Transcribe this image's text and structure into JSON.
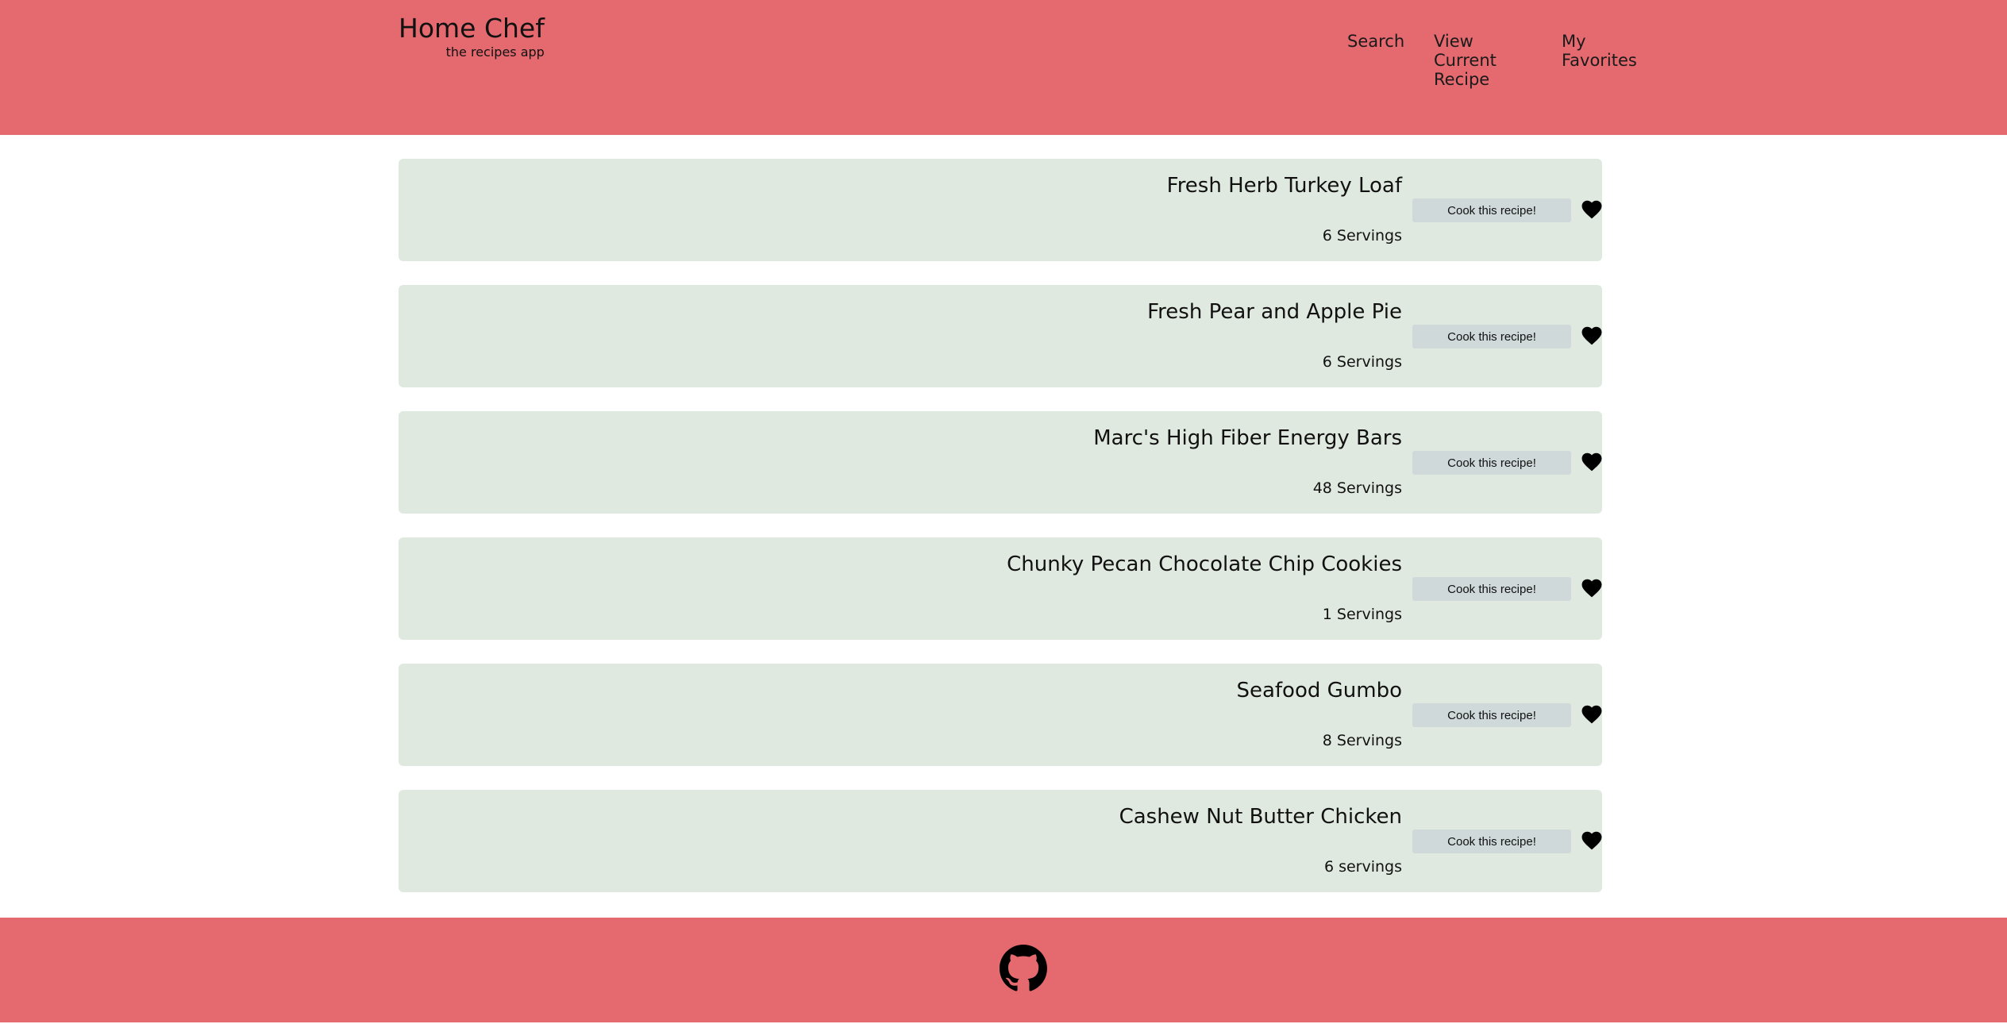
{
  "header": {
    "title": "Home Chef",
    "subtitle": "the recipes app",
    "nav": {
      "search": "Search",
      "current_recipe": "View Current Recipe",
      "favorites": "My Favorites"
    }
  },
  "recipes": [
    {
      "title": "Fresh Herb Turkey Loaf",
      "servings": "6 Servings",
      "button": "Cook this recipe!"
    },
    {
      "title": "Fresh Pear and Apple Pie",
      "servings": "6 Servings",
      "button": "Cook this recipe!"
    },
    {
      "title": "Marc's High Fiber Energy Bars",
      "servings": "48 Servings",
      "button": "Cook this recipe!"
    },
    {
      "title": "Chunky Pecan Chocolate Chip Cookies",
      "servings": "1 Servings",
      "button": "Cook this recipe!"
    },
    {
      "title": "Seafood Gumbo",
      "servings": "8 Servings",
      "button": "Cook this recipe!"
    },
    {
      "title": "Cashew Nut Butter Chicken",
      "servings": "6 servings",
      "button": "Cook this recipe!"
    }
  ],
  "icons": {
    "favorite": "heart-icon",
    "footer_link": "github-icon"
  },
  "colors": {
    "header_bg": "#e46a6f",
    "card_bg": "#e0e9e0",
    "button_bg": "#cfd9da"
  }
}
